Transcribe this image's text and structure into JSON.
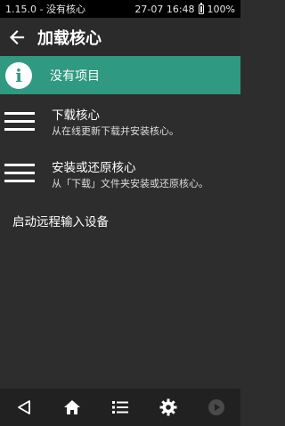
{
  "status_bar": {
    "left_text": "1.15.0 - 没有核心",
    "datetime": "27-07 16:48",
    "battery": "100%"
  },
  "app_bar": {
    "title": "加载核心",
    "back_icon": "back-arrow-icon"
  },
  "banner": {
    "icon_letter": "i",
    "text": "没有项目",
    "color": "#2f9a81"
  },
  "menu": {
    "items": [
      {
        "title": "下载核心",
        "subtitle": "从在线更新下载并安装核心。",
        "icon": "hamburger-icon"
      },
      {
        "title": "安装或还原核心",
        "subtitle": "从「下载」文件夹安装或还原核心。",
        "icon": "hamburger-icon"
      }
    ],
    "remote_input": "启动远程输入设备"
  },
  "nav_bar": {
    "items": [
      "back-triangle-icon",
      "home-icon",
      "list-icon",
      "gear-icon",
      "play-icon"
    ]
  }
}
